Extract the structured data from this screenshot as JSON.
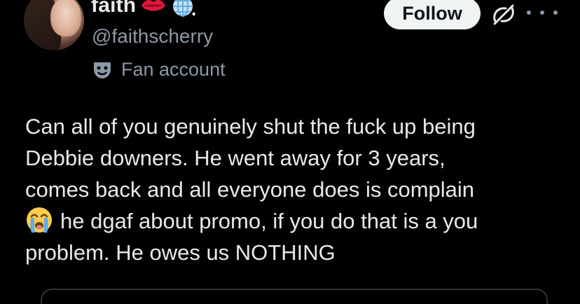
{
  "author": {
    "display_name": "faith",
    "handle": "@faithscherry",
    "affiliation": "Fan account",
    "name_emojis": [
      "lips-icon",
      "disco-ball-icon"
    ]
  },
  "actions": {
    "follow_label": "Follow",
    "grok_icon": "grok-icon",
    "more_icon": "more-icon"
  },
  "tweet": {
    "lines": [
      "Can all of you genuinely shut the fuck up being",
      "Debbie downers. He went away for 3 years,",
      "comes back and all everyone does is complain",
      "he dgaf about promo, if you do that is a you",
      "problem. He owes us NOTHING"
    ],
    "inline_emoji": "loudly-crying-face-icon"
  },
  "colors": {
    "background": "#000000",
    "text_primary": "#e7e9ea",
    "text_secondary": "#8b98a5",
    "follow_bg": "#eff3f4",
    "follow_text": "#0f1419"
  }
}
